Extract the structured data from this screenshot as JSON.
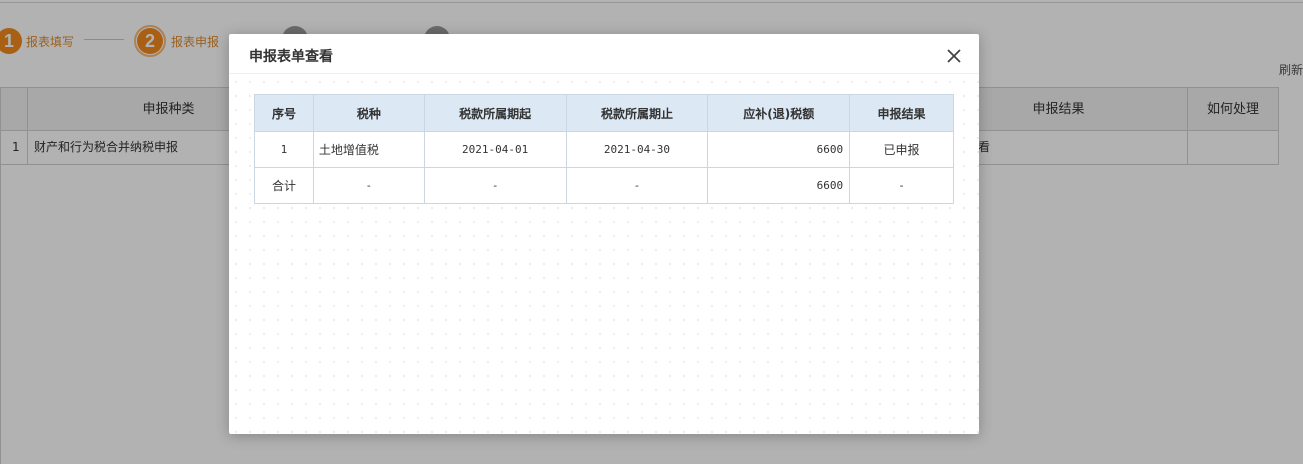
{
  "steps": [
    {
      "number": "1",
      "label": "报表填写",
      "state": "done"
    },
    {
      "number": "2",
      "label": "报表申报",
      "state": "active"
    },
    {
      "number": "",
      "label": "",
      "state": "pending"
    },
    {
      "number": "",
      "label": "",
      "state": "pending"
    }
  ],
  "toolbar": {
    "refresh_label": "刷新"
  },
  "background_table": {
    "headers": [
      "申报种类",
      "申报结果",
      "如何处理"
    ],
    "rows": [
      {
        "index": "1",
        "type": "财产和行为税合并纳税申报",
        "result_fragment": "看",
        "action": ""
      }
    ]
  },
  "modal": {
    "title": "申报表单查看",
    "close_icon": "close-icon",
    "columns": [
      "序号",
      "税种",
      "税款所属期起",
      "税款所属期止",
      "应补(退)税额",
      "申报结果"
    ],
    "rows": [
      {
        "seq": "1",
        "tax_type": "土地增值税",
        "period_start": "2021-04-01",
        "period_end": "2021-04-30",
        "amount": "6600",
        "result": "已申报"
      }
    ],
    "total": {
      "seq": "合计",
      "tax_type": "-",
      "period_start": "-",
      "period_end": "-",
      "amount": "6600",
      "result": "-"
    }
  },
  "colors": {
    "accent": "#f28a1e",
    "header_bg": "#dce9f5",
    "border": "#c9d6e3"
  }
}
